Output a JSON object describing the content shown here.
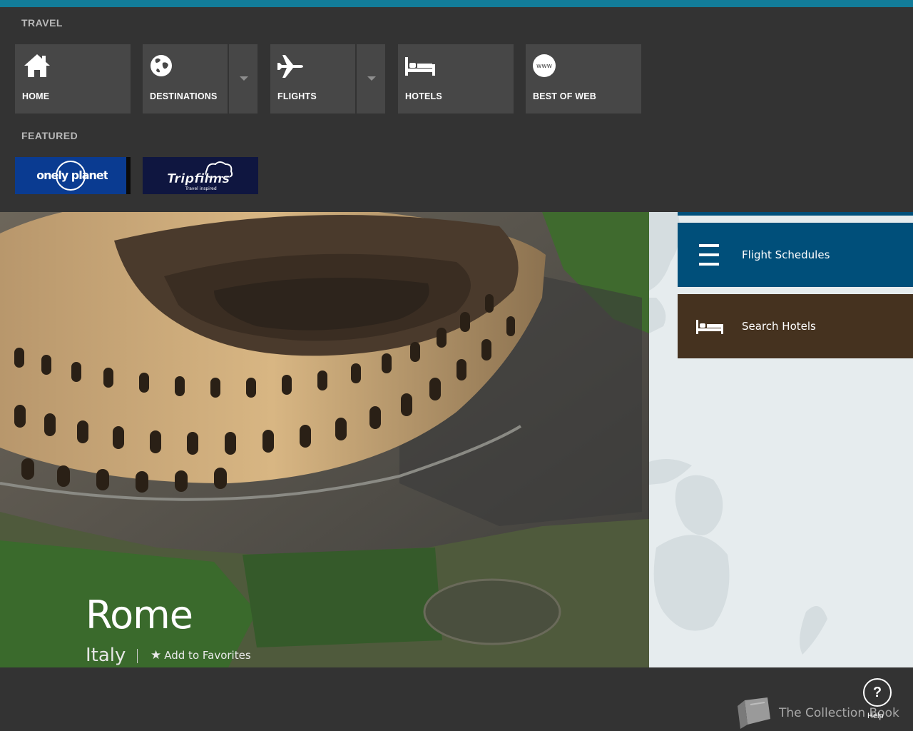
{
  "nav": {
    "section_travel": "TRAVEL",
    "tiles": {
      "home": "HOME",
      "destinations": "DESTINATIONS",
      "flights": "FLIGHTS",
      "hotels": "HOTELS",
      "best_of_web": "BEST OF WEB"
    },
    "www_glyph": "www",
    "section_featured": "FEATURED",
    "featured": {
      "lonely_planet": "lonely planet",
      "tripfilms": "Tripfilms",
      "tripfilms_tagline": "Travel inspired"
    }
  },
  "hero": {
    "city": "Rome",
    "country": "Italy",
    "favorites_label": "Add to Favorites"
  },
  "actions": {
    "flight_schedules": "Flight Schedules",
    "search_hotels": "Search Hotels"
  },
  "footer": {
    "collection": "The Collection Book",
    "help_glyph": "?",
    "help_label": "Help"
  },
  "colors": {
    "accent": "#127c99",
    "flight_tile": "#004f7a",
    "hotel_tile": "#45321f"
  }
}
